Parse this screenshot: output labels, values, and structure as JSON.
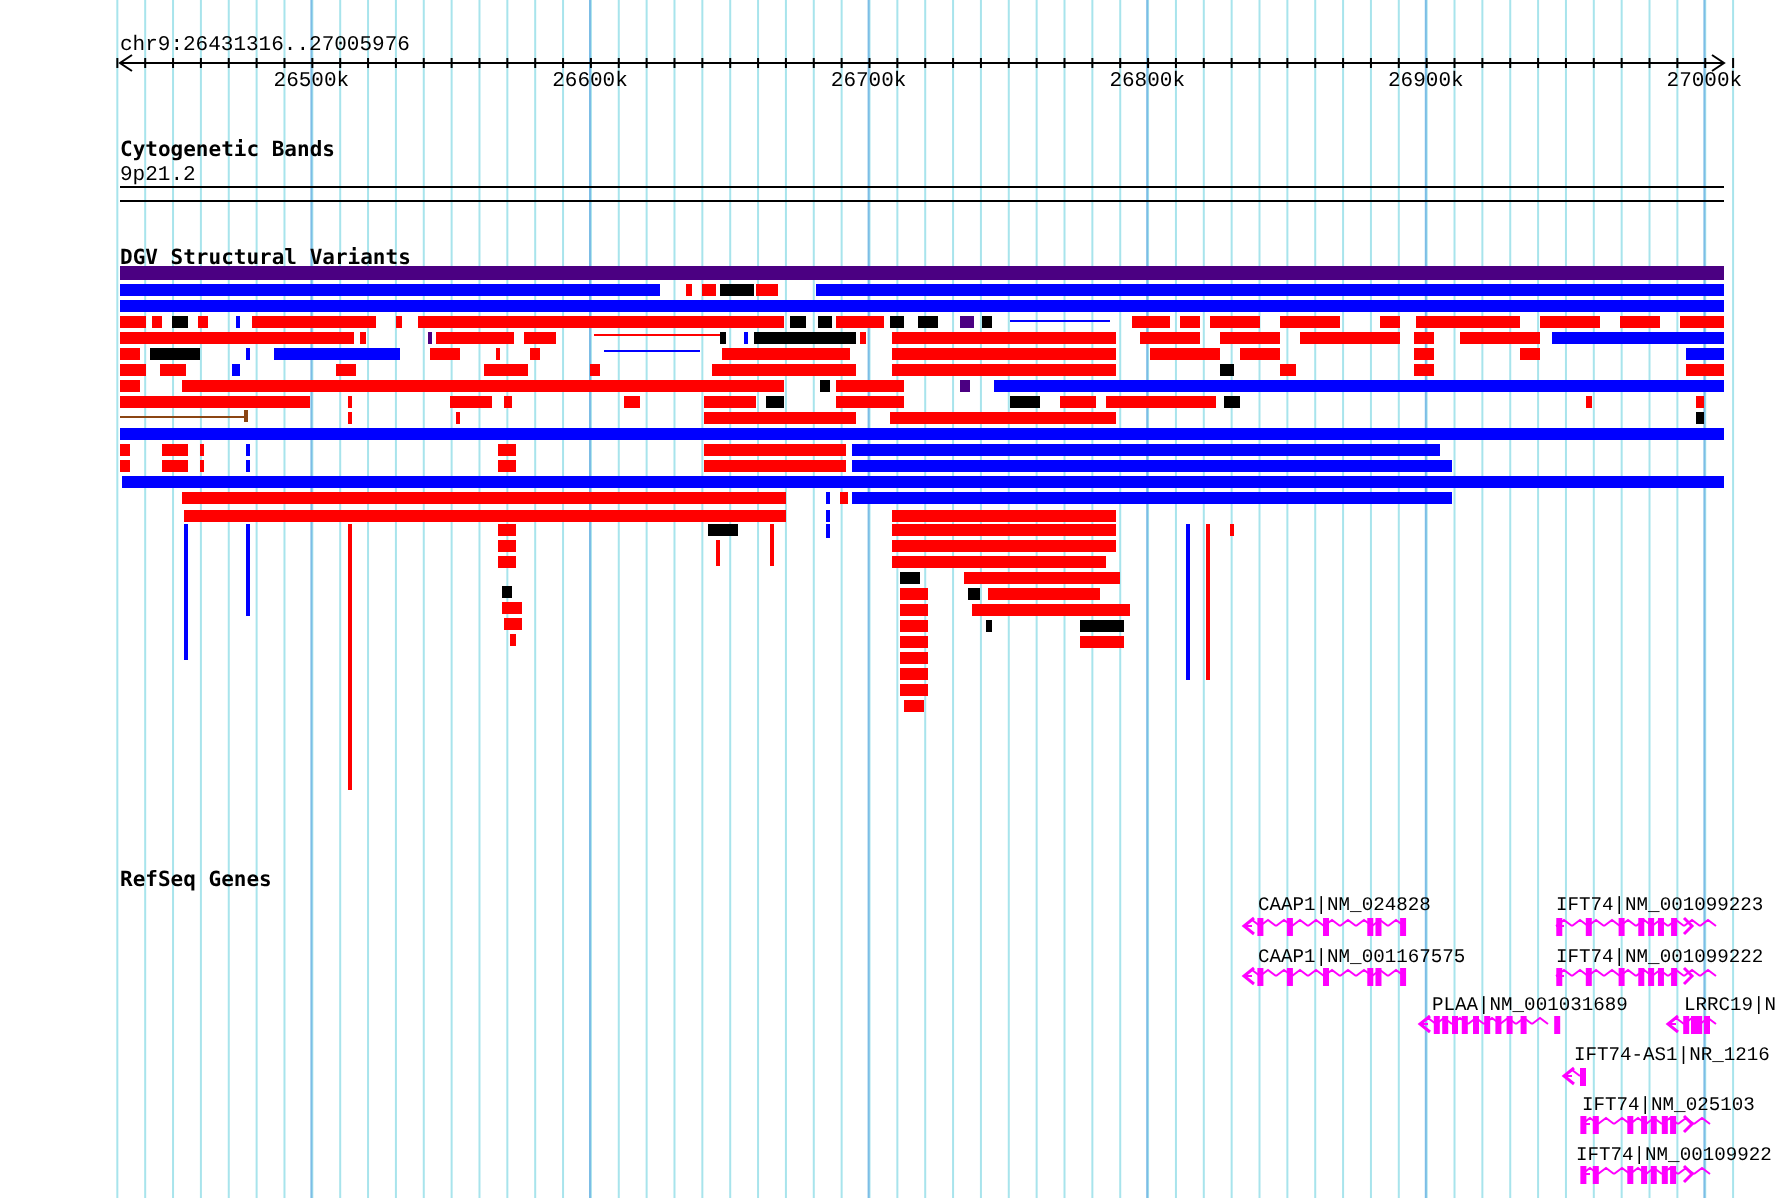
{
  "position": "chr9:26431316..27005976",
  "axis": {
    "ticks": [
      "26500k",
      "26600k",
      "26700k",
      "26800k",
      "26900k",
      "27000k"
    ]
  },
  "cytogenetic_bands": {
    "title": "Cytogenetic Bands",
    "band": "9p21.2"
  },
  "dgv_variants": {
    "title": "DGV Structural Variants"
  },
  "refseq_genes": {
    "title": "RefSeq Genes",
    "genes": [
      {
        "label": "CAAP1|NM_024828",
        "kind": "reverse"
      },
      {
        "label": "IFT74|NM_001099223",
        "kind": "forward"
      },
      {
        "label": "CAAP1|NM_001167575",
        "kind": "reverse"
      },
      {
        "label": "IFT74|NM_001099222",
        "kind": "forward"
      },
      {
        "label": "PLAA|NM_001031689",
        "kind": "reverse"
      },
      {
        "label": "LRRC19|N",
        "kind": "reverse"
      },
      {
        "label": "IFT74-AS1|NR_1216",
        "kind": "reverse"
      },
      {
        "label": "IFT74|NM_025103",
        "kind": "forward"
      },
      {
        "label": "IFT74|NM_00109922",
        "kind": "forward"
      }
    ]
  }
}
